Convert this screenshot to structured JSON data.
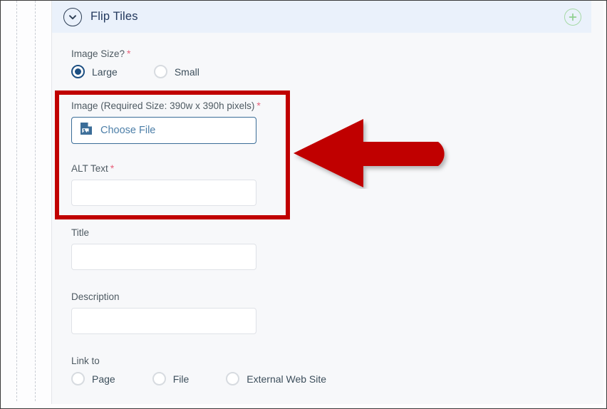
{
  "section": {
    "title": "Flip Tiles",
    "collapse_icon": "chevron-down-icon",
    "add_icon": "plus-circle-icon",
    "header_bg": "#eaf1fb",
    "title_color": "#23395d",
    "add_icon_color": "#8fcf8f"
  },
  "fields": {
    "image_size": {
      "label": "Image Size?",
      "required": true,
      "options": [
        {
          "label": "Large",
          "selected": true
        },
        {
          "label": "Small",
          "selected": false
        }
      ]
    },
    "image": {
      "label": "Image (Required Size: 390w x 390h pixels)",
      "required": true,
      "button_label": "Choose File",
      "button_icon": "image-file-icon",
      "button_border_color": "#3b6d98",
      "button_text_color": "#4d7fa8"
    },
    "alt_text": {
      "label": "ALT Text",
      "required": true,
      "value": "",
      "placeholder": ""
    },
    "title": {
      "label": "Title",
      "required": false,
      "value": "",
      "placeholder": ""
    },
    "description": {
      "label": "Description",
      "required": false,
      "value": "",
      "placeholder": ""
    },
    "link_to": {
      "label": "Link to",
      "required": false,
      "options": [
        {
          "label": "Page",
          "selected": false
        },
        {
          "label": "File",
          "selected": false
        },
        {
          "label": "External Web Site",
          "selected": false
        }
      ]
    }
  },
  "annotations": {
    "highlight_box": {
      "name": "red-highlight-rectangle",
      "color": "#c00000",
      "border_width_px": 6
    },
    "arrow": {
      "name": "red-left-arrow",
      "color": "#c00000",
      "direction": "left"
    }
  },
  "required_marker": "*",
  "accent_colors": {
    "radio_selected": "#1d4f82",
    "required_star": "#e8607a",
    "panel_bg": "#f7f8fa",
    "input_border": "#dfe2e7"
  }
}
